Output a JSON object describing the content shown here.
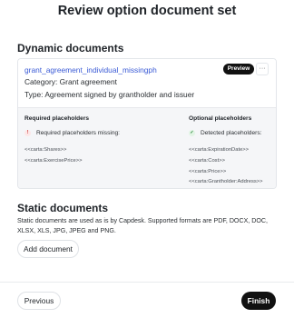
{
  "modal": {
    "title": "Review option document set"
  },
  "dynamic": {
    "section_title": "Dynamic documents",
    "document": {
      "name": "grant_agreement_individual_missingph",
      "category": "Category: Grant agreement",
      "type": "Type: Agreement signed by grantholder and issuer",
      "preview_label": "Preview",
      "more_label": "···"
    },
    "required": {
      "header": "Required placeholders",
      "status": "Required placeholders missing:",
      "status_icon": "!",
      "items": [
        "<<carta:Shares>>",
        "<<carta:ExercisePrice>>"
      ]
    },
    "optional": {
      "header": "Optional placeholders",
      "status": "Detected placeholders:",
      "status_icon": "✓",
      "items": [
        "<<carta:ExpirationDate>>",
        "<<carta:Cost>>",
        "<<carta:Price>>",
        "<<carta:Grantholder:Address>>"
      ]
    }
  },
  "static": {
    "section_title": "Static documents",
    "description": "Static documents are used as is by Capdesk. Supported formats are PDF, DOCX, DOC, XLSX, XLS, JPG, JPEG and PNG.",
    "add_label": "Add document"
  },
  "footer": {
    "previous_label": "Previous",
    "finish_label": "Finish"
  },
  "colors": {
    "link": "#3b5bd6",
    "primary_button": "#111111",
    "warning": "#c83737",
    "success": "#2a8a3a"
  }
}
